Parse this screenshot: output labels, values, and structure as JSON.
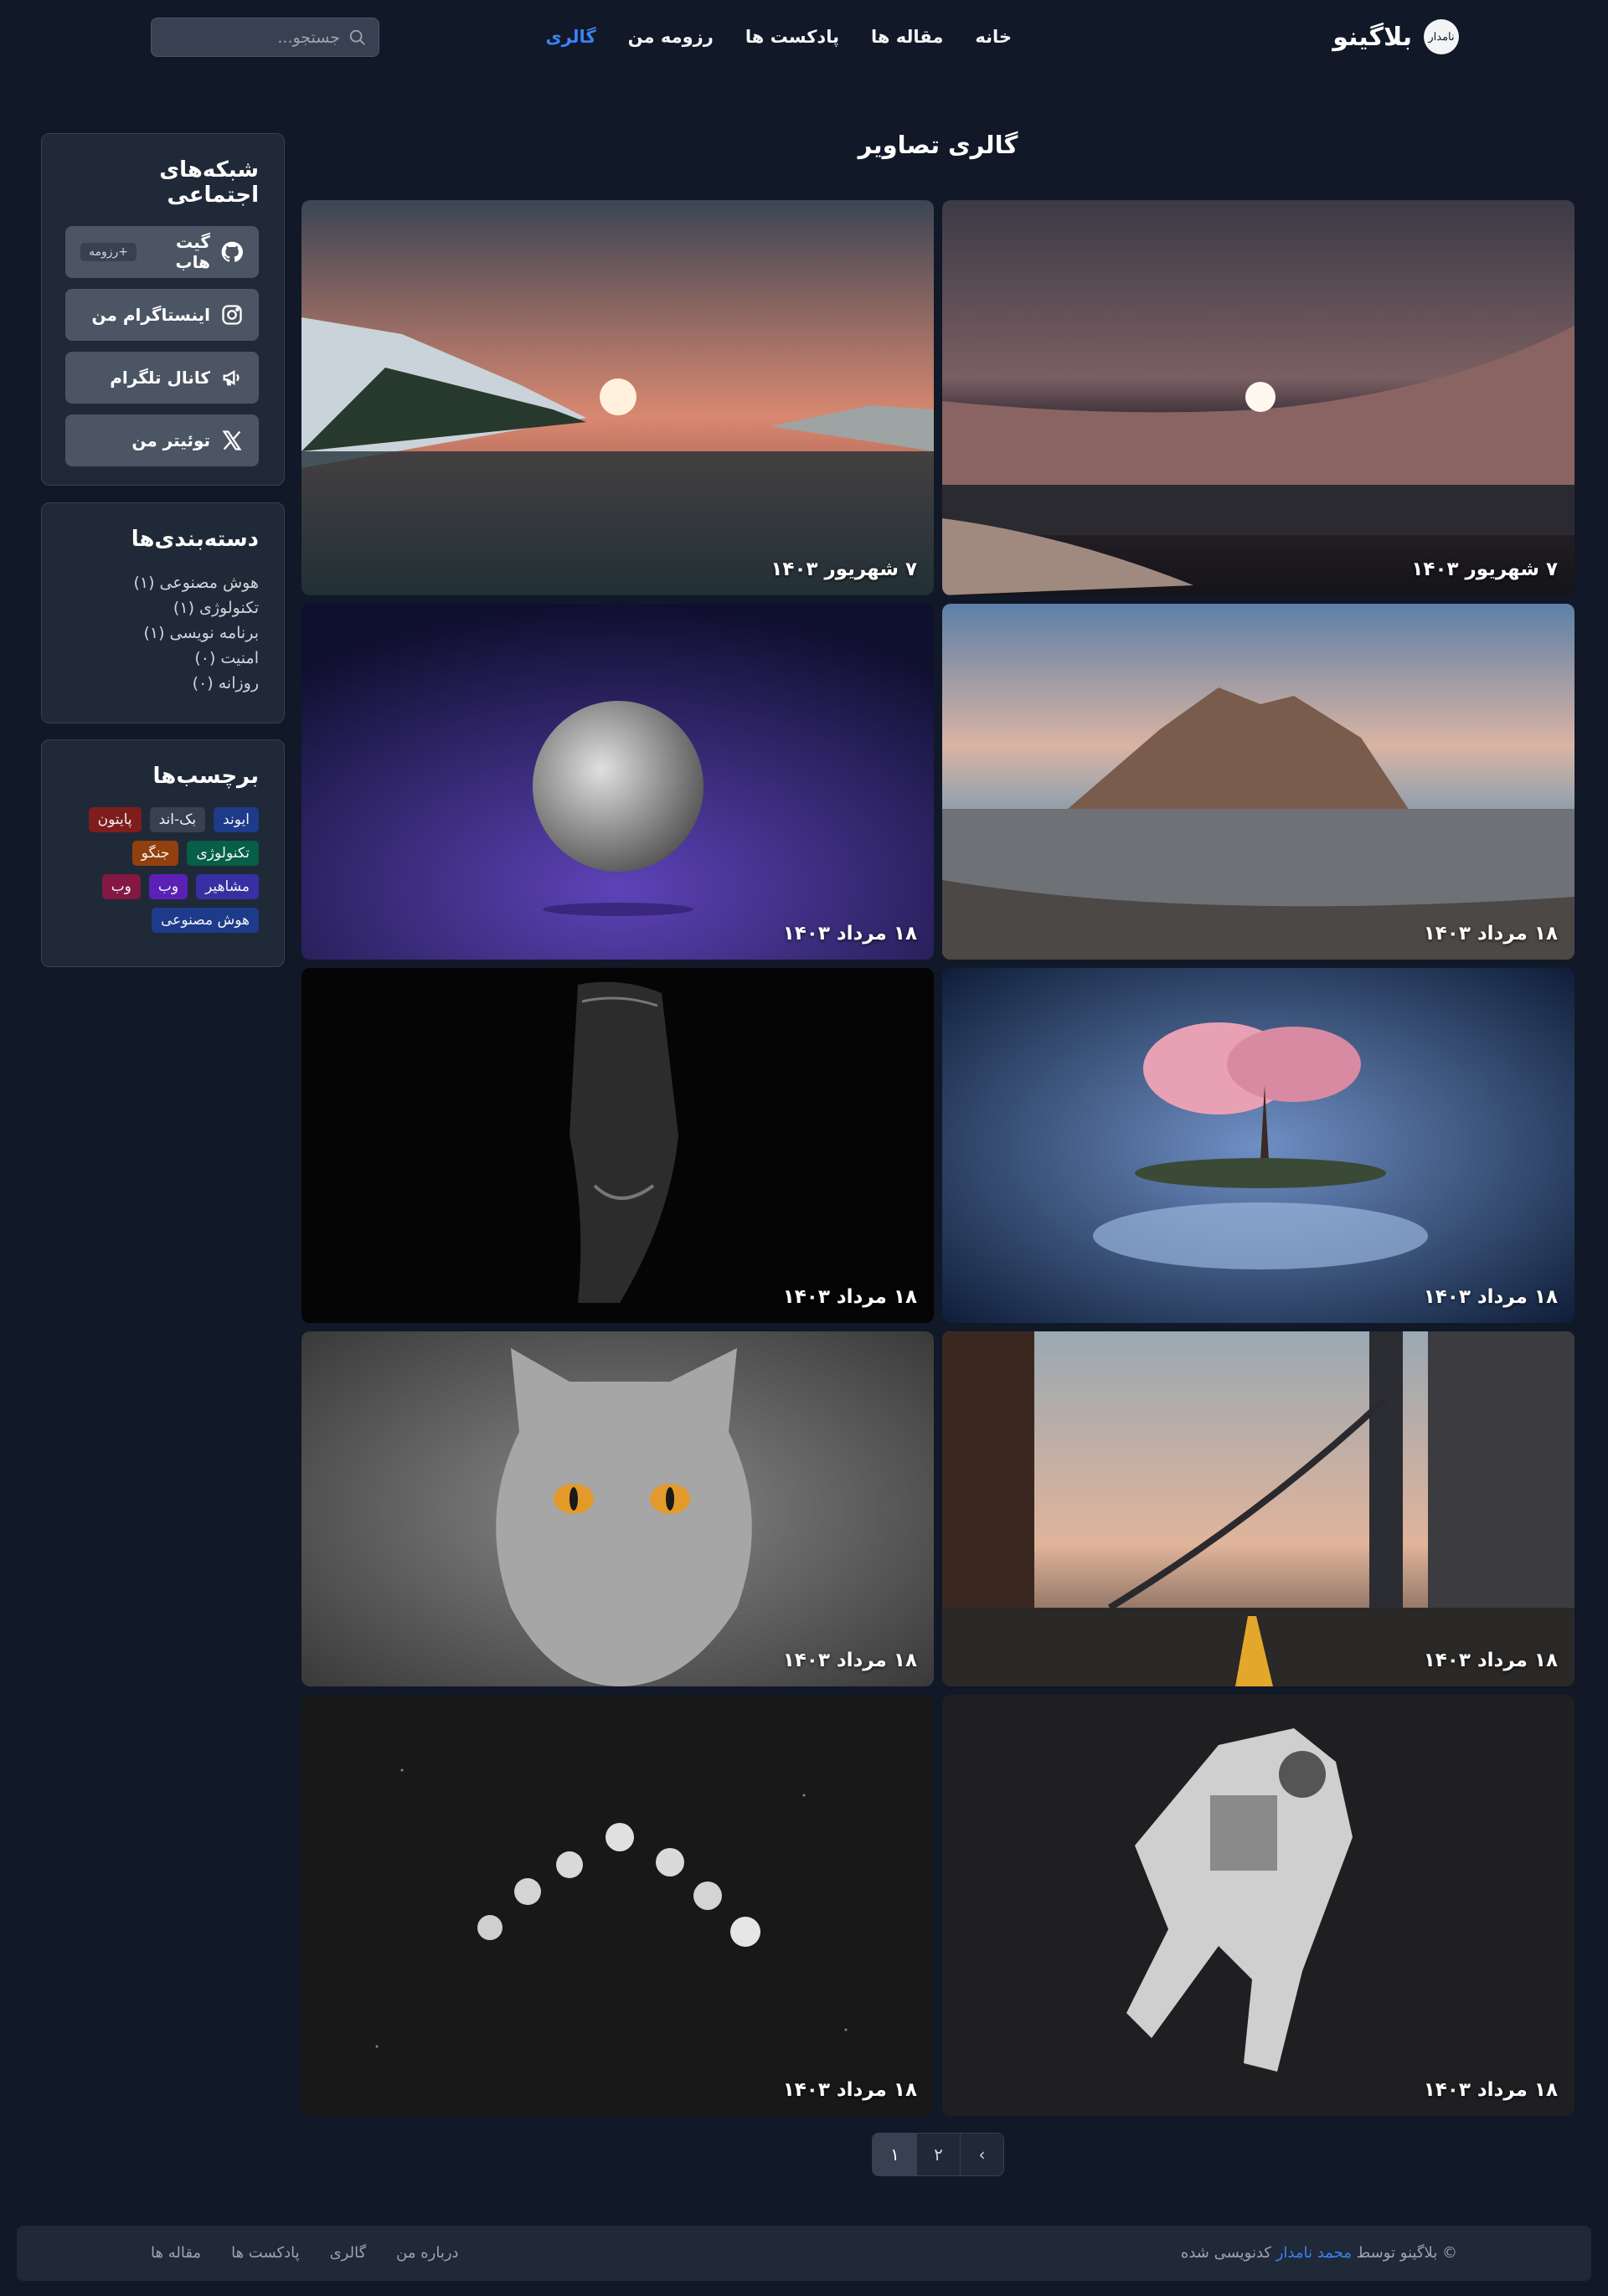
{
  "header": {
    "brand_name": "بلاگینو",
    "logo_text": "نامدار",
    "nav": [
      "خانه",
      "مقاله ها",
      "پادکست ها",
      "رزومه من",
      "گالری"
    ],
    "active_nav": "گالری",
    "search_placeholder": "جستجو..."
  },
  "sidebar": {
    "social": {
      "title": "شبکه‌های اجتماعی",
      "items": [
        {
          "label": "گیت هاب",
          "icon": "github-icon",
          "badge": "+رزومه"
        },
        {
          "label": "اینستاگرام من",
          "icon": "instagram-icon"
        },
        {
          "label": "کانال تلگرام",
          "icon": "megaphone-icon"
        },
        {
          "label": "توئیتر من",
          "icon": "x-icon"
        }
      ]
    },
    "categories": {
      "title": "دسته‌بندی‌ها",
      "items": [
        "هوش مصنوعی (۱)",
        "تکنولوژی (۱)",
        "برنامه نویسی (۱)",
        "امنیت (۰)",
        "روزانه (۰)"
      ]
    },
    "tags": {
      "title": "برچسب‌ها",
      "items": [
        {
          "label": "ایوند",
          "color": "#1e3a8a"
        },
        {
          "label": "بک-اند",
          "color": "#374151"
        },
        {
          "label": "پایتون",
          "color": "#7f1d1d"
        },
        {
          "label": "تکنولوژی",
          "color": "#065f46"
        },
        {
          "label": "جنگو",
          "color": "#92400e"
        },
        {
          "label": "مشاهیر",
          "color": "#3730a3"
        },
        {
          "label": "وب",
          "color": "#5b21b6"
        },
        {
          "label": "وب",
          "color": "#831843"
        },
        {
          "label": "هوش مصنوعی",
          "color": "#1e3a8a"
        }
      ]
    }
  },
  "gallery": {
    "title": "گالری تصاویر",
    "items": [
      {
        "date": "۷ شهریور ۱۴۰۳",
        "scene": "desert-sunset"
      },
      {
        "date": "۷ شهریور ۱۴۰۳",
        "scene": "lake-sunset"
      },
      {
        "date": "۱۸ مرداد ۱۴۰۳",
        "scene": "mountain-lake"
      },
      {
        "date": "۱۸ مرداد ۱۴۰۳",
        "scene": "moon"
      },
      {
        "date": "۱۸ مرداد ۱۴۰۳",
        "scene": "cherry-tree-island"
      },
      {
        "date": "۱۸ مرداد ۱۴۰۳",
        "scene": "anonymous-mask"
      },
      {
        "date": "۱۸ مرداد ۱۴۰۳",
        "scene": "bridge-street"
      },
      {
        "date": "۱۸ مرداد ۱۴۰۳",
        "scene": "grey-cat"
      },
      {
        "date": "۱۸ مرداد ۱۴۰۳",
        "scene": "astronaut"
      },
      {
        "date": "۱۸ مرداد ۱۴۰۳",
        "scene": "moon-phases"
      }
    ]
  },
  "pagination": {
    "pages": [
      "۱",
      "۲"
    ],
    "current": "۱",
    "next": "›"
  },
  "footer": {
    "copyright_prefix": "© بلاگینو توسط",
    "author": "محمد نامدار",
    "copyright_suffix": "کدنویسی شده",
    "links": [
      "مقاله ها",
      "پادکست ها",
      "گالری",
      "درباره من"
    ]
  }
}
